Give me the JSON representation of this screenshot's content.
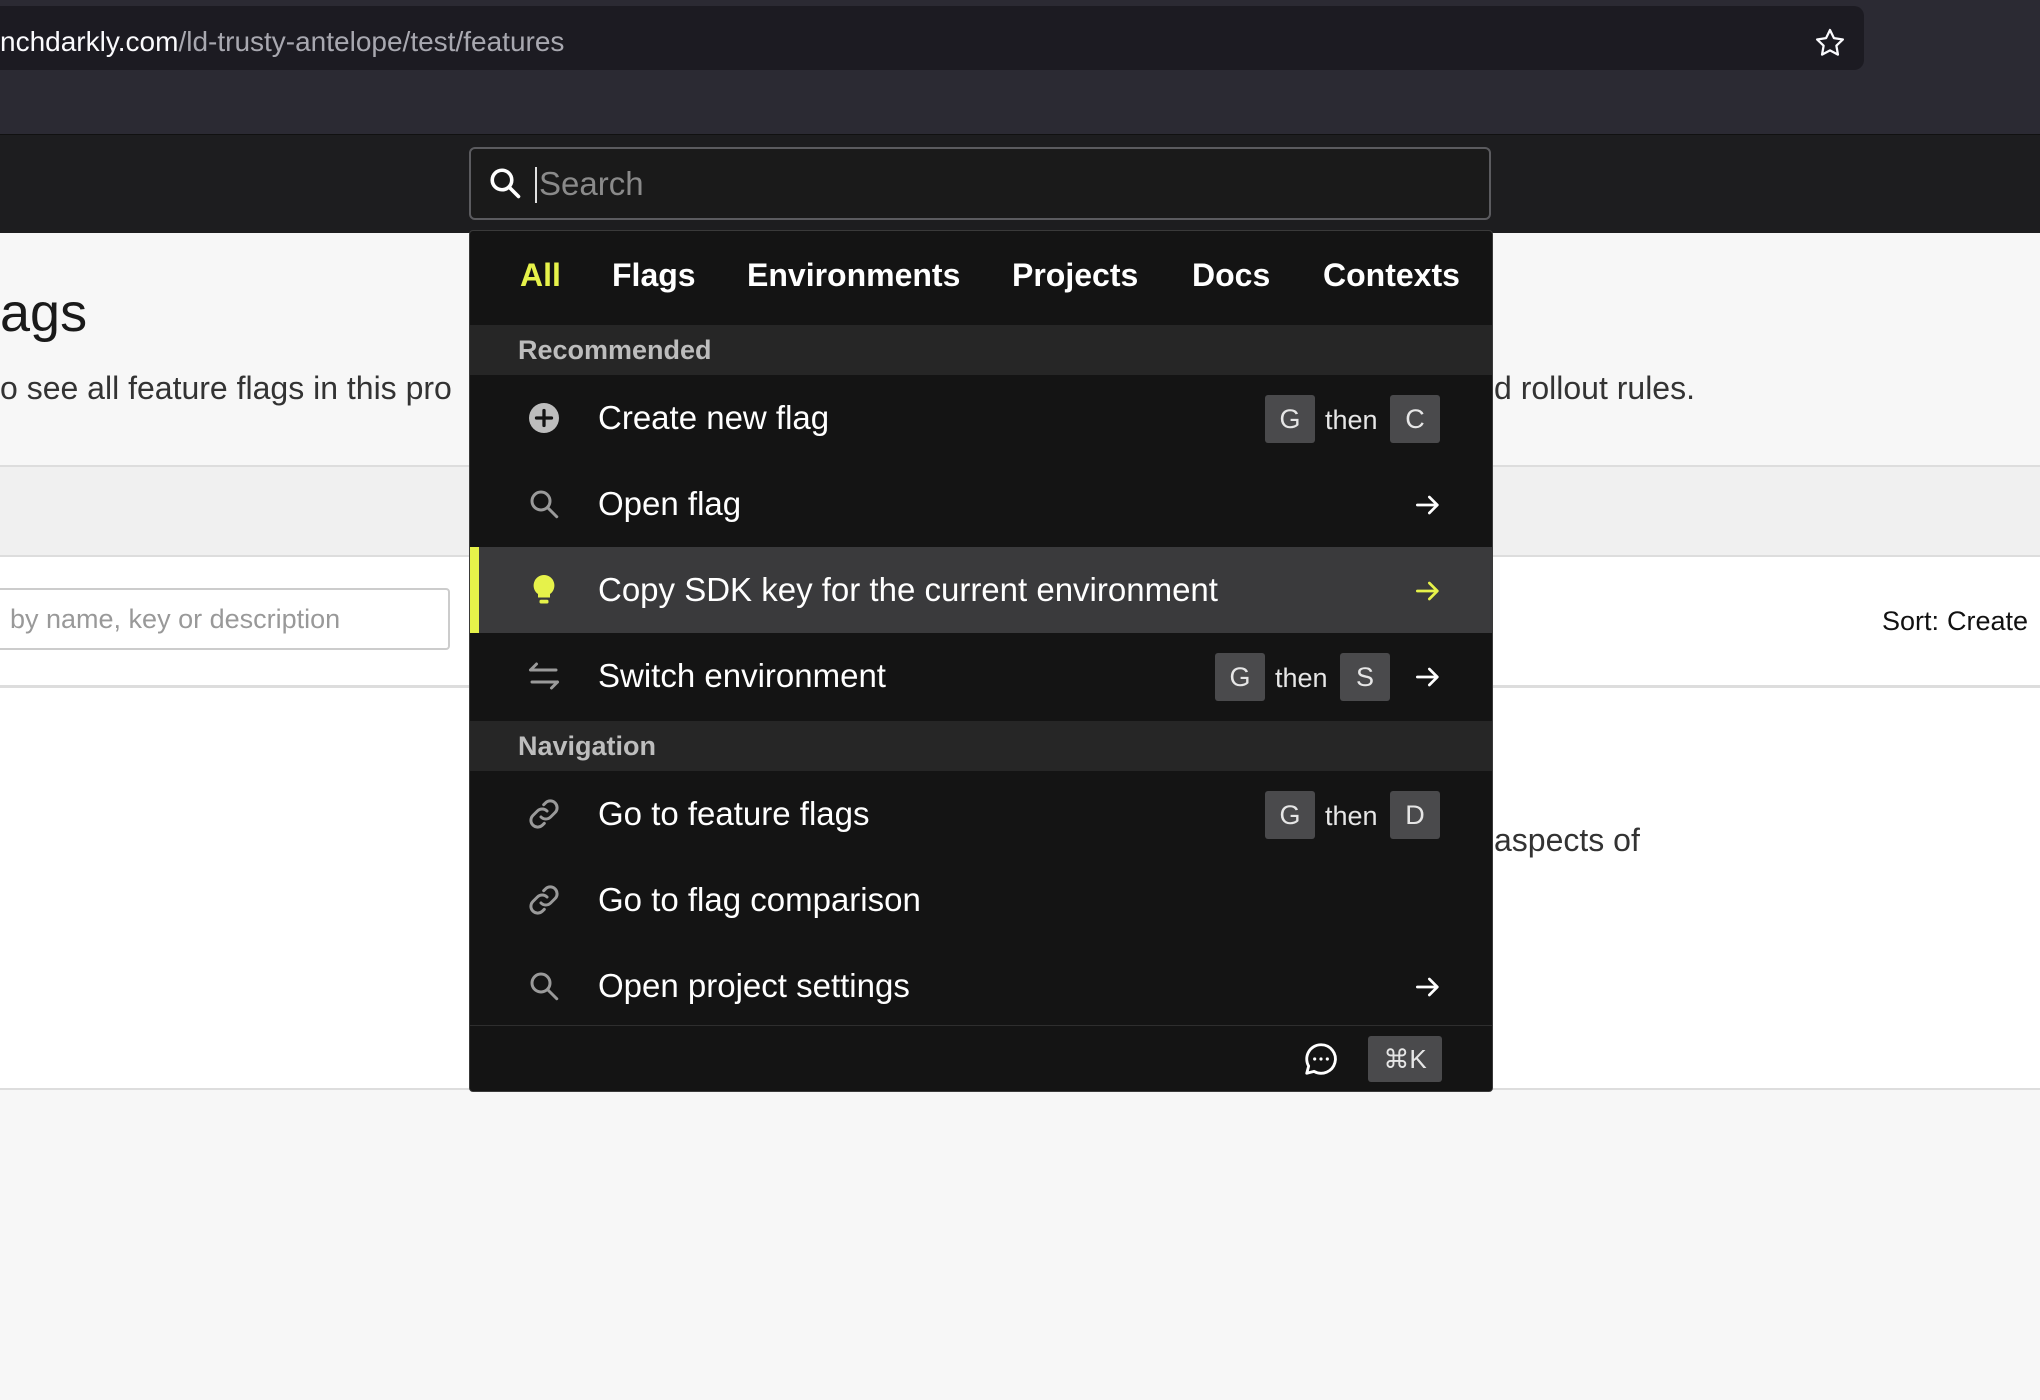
{
  "browser": {
    "url_host": "nchdarkly.com",
    "url_path": "/ld-trusty-antelope/test/features"
  },
  "page": {
    "title_fragment": "ags",
    "description_left": "o see all feature flags in this pro",
    "description_right": "d rollout rules.",
    "filter_placeholder": "by name, key or description",
    "sort_label": "Sort:",
    "sort_value": "Create",
    "content_fragment": "aspects of"
  },
  "search": {
    "placeholder": "Search"
  },
  "tabs": [
    {
      "label": "All",
      "active": true
    },
    {
      "label": "Flags"
    },
    {
      "label": "Environments"
    },
    {
      "label": "Projects"
    },
    {
      "label": "Docs"
    },
    {
      "label": "Contexts"
    }
  ],
  "sections": {
    "recommended": "Recommended",
    "navigation": "Navigation"
  },
  "items": [
    {
      "label": "Create new flag",
      "icon": "plus-circle-icon",
      "shortcut": [
        "G",
        "then",
        "C"
      ]
    },
    {
      "label": "Open flag",
      "icon": "search-icon",
      "arrow": true
    },
    {
      "label": "Copy SDK key for the current environment",
      "icon": "lightbulb-icon",
      "arrow": true,
      "highlighted": true
    },
    {
      "label": "Switch environment",
      "icon": "switch-arrows-icon",
      "shortcut": [
        "G",
        "then",
        "S"
      ],
      "arrow": true
    },
    {
      "label": "Go to feature flags",
      "icon": "link-icon",
      "shortcut": [
        "G",
        "then",
        "D"
      ]
    },
    {
      "label": "Go to flag comparison",
      "icon": "link-icon"
    },
    {
      "label": "Open project settings",
      "icon": "search-icon",
      "arrow": true
    }
  ],
  "footer": {
    "shortcut": "⌘K",
    "icon": "chat-icon"
  },
  "colors": {
    "accent": "#e6f24a",
    "palette_bg": "#141414",
    "highlight_bg": "#3a3a3c"
  }
}
